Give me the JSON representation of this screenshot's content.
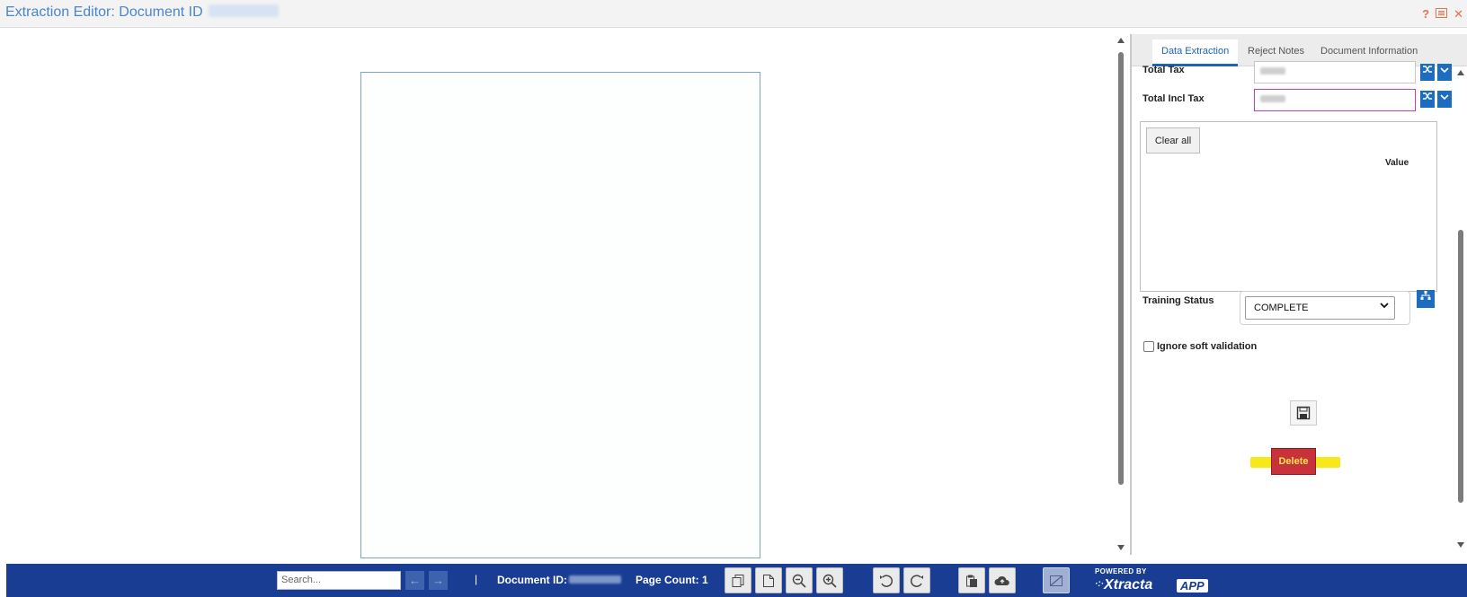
{
  "titlebar": {
    "title": "Extraction Editor: Document ID",
    "help_icon": "?",
    "close_icon": "✕"
  },
  "panel": {
    "tabs": [
      {
        "label": "Data Extraction",
        "active": true
      },
      {
        "label": "Reject Notes",
        "active": false
      },
      {
        "label": "Document Information",
        "active": false
      }
    ],
    "fields": [
      {
        "label": "Total Tax"
      },
      {
        "label": "Total Incl Tax"
      }
    ],
    "clear_all_label": "Clear all",
    "grid_value_header": "Value",
    "training_status_label": "Training Status",
    "training_status_value": "COMPLETE",
    "ignore_soft_validation_label": "Ignore soft validation",
    "delete_label": "Delete"
  },
  "footer": {
    "search_placeholder": "Search...",
    "separator": "|",
    "document_id_label": "Document ID:",
    "page_count_label": "Page Count: 1",
    "powered_by": "POWERED BY",
    "brand_name": "Xtracta",
    "brand_app": "APP"
  },
  "colors": {
    "footer_bg": "#183d93",
    "title_blue": "#4b86c8",
    "active_tab": "#1d63b8",
    "delete_bg": "#c8323a",
    "highlight_yellow": "#f8e81a",
    "error_border": "#d63aa0"
  }
}
